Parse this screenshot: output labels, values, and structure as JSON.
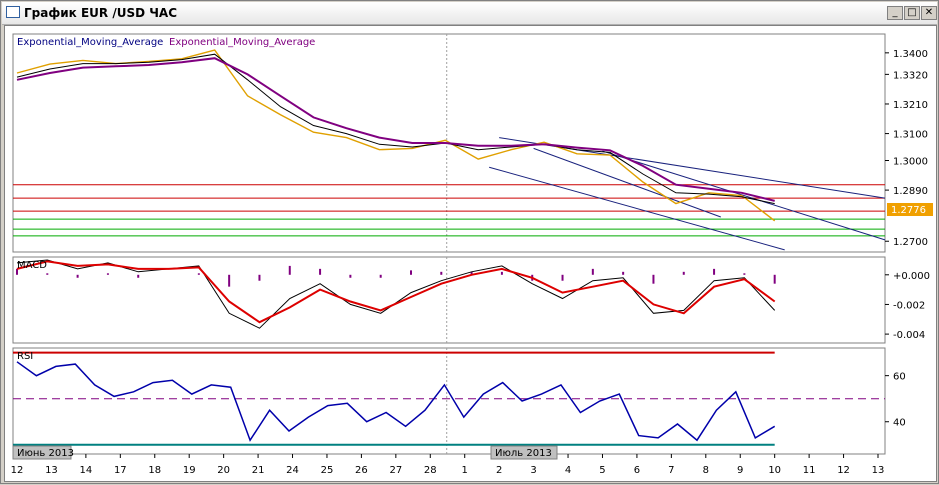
{
  "window": {
    "title": "График EUR /USD  ЧАС",
    "buttons": {
      "minimize": "_",
      "maximize": "□",
      "close": "✕"
    }
  },
  "colors": {
    "price": "#e0a000",
    "ema_fast": "#000000",
    "ema_slow": "#800080",
    "macd_line": "#000000",
    "signal_line": "#dd0000",
    "histogram": "#800080",
    "rsi_line": "#0000aa",
    "rsi_upper": "#cc0000",
    "rsi_mid": "#800080",
    "rsi_lower": "#008080",
    "level_red": "#cc0000",
    "level_green": "#00aa00",
    "channel": "#1a237e",
    "last_price_box": "#f0a000"
  },
  "chart_data": [
    {
      "type": "line",
      "name": "price",
      "legend": [
        "Exponential_Moving_Average",
        "Exponential_Moving_Average"
      ],
      "ylim": [
        1.266,
        1.347
      ],
      "y_ticks": [
        "1.3400",
        "1.3320",
        "1.3210",
        "1.3100",
        "1.3000",
        "1.2890",
        "1.2776",
        "1.2700"
      ],
      "last_price": "1.2776",
      "x": [
        "12",
        "13",
        "14",
        "17",
        "18",
        "19",
        "20",
        "21",
        "24",
        "25",
        "26",
        "27",
        "28",
        "1",
        "2",
        "3",
        "4",
        "5",
        "6",
        "7",
        "8",
        "9",
        "10",
        "11",
        "12",
        "13"
      ],
      "series": [
        {
          "name": "price",
          "values": [
            1.3325,
            1.3358,
            1.3372,
            1.336,
            1.3368,
            1.3378,
            1.341,
            1.324,
            1.317,
            1.3105,
            1.3085,
            1.304,
            1.3045,
            1.3075,
            1.3005,
            1.304,
            1.3068,
            1.3025,
            1.302,
            1.292,
            1.284,
            1.288,
            1.287,
            1.2776
          ]
        },
        {
          "name": "ema_fast",
          "values": [
            1.331,
            1.334,
            1.336,
            1.336,
            1.3365,
            1.3375,
            1.3395,
            1.33,
            1.32,
            1.313,
            1.31,
            1.306,
            1.305,
            1.3065,
            1.304,
            1.305,
            1.306,
            1.304,
            1.303,
            1.295,
            1.288,
            1.2875,
            1.2865,
            1.284
          ]
        },
        {
          "name": "ema_slow",
          "values": [
            1.33,
            1.3325,
            1.3345,
            1.335,
            1.3355,
            1.3365,
            1.338,
            1.332,
            1.324,
            1.316,
            1.312,
            1.3085,
            1.3065,
            1.3065,
            1.3055,
            1.3055,
            1.306,
            1.3048,
            1.3038,
            1.298,
            1.291,
            1.2895,
            1.288,
            1.285
          ]
        }
      ],
      "horizontal_levels": [
        {
          "value": 1.291,
          "color": "red"
        },
        {
          "value": 1.286,
          "color": "red"
        },
        {
          "value": 1.2812,
          "color": "red"
        },
        {
          "value": 1.2782,
          "color": "green"
        },
        {
          "value": 1.2745,
          "color": "green"
        },
        {
          "value": 1.272,
          "color": "green"
        }
      ]
    },
    {
      "type": "line",
      "name": "MACD",
      "title": "MACD",
      "ylim": [
        -0.0046,
        0.0012
      ],
      "y_ticks": [
        "+0.000",
        "-0.002",
        "-0.004"
      ],
      "series": [
        {
          "name": "macd",
          "values": [
            0.0008,
            0.001,
            0.0004,
            0.0008,
            0.0002,
            0.0004,
            0.0006,
            -0.0026,
            -0.0036,
            -0.0016,
            -0.0006,
            -0.002,
            -0.0026,
            -0.0012,
            -0.0004,
            0.0002,
            0.0006,
            -0.0006,
            -0.0016,
            -0.0004,
            -0.0002,
            -0.0026,
            -0.0024,
            -0.0004,
            -0.0002,
            -0.0024
          ]
        },
        {
          "name": "signal",
          "values": [
            0.0004,
            0.0009,
            0.0006,
            0.0007,
            0.0004,
            0.0004,
            0.0005,
            -0.0018,
            -0.0032,
            -0.0022,
            -0.001,
            -0.0018,
            -0.0024,
            -0.0015,
            -0.0006,
            0.0,
            0.0004,
            -0.0002,
            -0.0012,
            -0.0008,
            -0.0004,
            -0.002,
            -0.0026,
            -0.0008,
            -0.0003,
            -0.0018
          ]
        }
      ]
    },
    {
      "type": "line",
      "name": "RSI",
      "title": "RSI",
      "ylim": [
        26,
        72
      ],
      "y_ticks": [
        "60",
        "40"
      ],
      "levels": {
        "upper": 70,
        "mid": 50,
        "lower": 30
      },
      "values": [
        66,
        60,
        64,
        65,
        56,
        51,
        53,
        57,
        58,
        52,
        56,
        55,
        32,
        45,
        36,
        42,
        47,
        48,
        40,
        44,
        38,
        45,
        56,
        42,
        52,
        57,
        49,
        52,
        56,
        44,
        49,
        52,
        34,
        33,
        39,
        32,
        45,
        53,
        33,
        38
      ]
    }
  ],
  "x_axis": {
    "labels": [
      "12",
      "13",
      "14",
      "17",
      "18",
      "19",
      "20",
      "21",
      "24",
      "25",
      "26",
      "27",
      "28",
      "1",
      "2",
      "3",
      "4",
      "5",
      "6",
      "7",
      "8",
      "9",
      "10",
      "11",
      "12",
      "13"
    ],
    "month_markers": [
      "Июнь 2013",
      "Июль 2013"
    ]
  }
}
